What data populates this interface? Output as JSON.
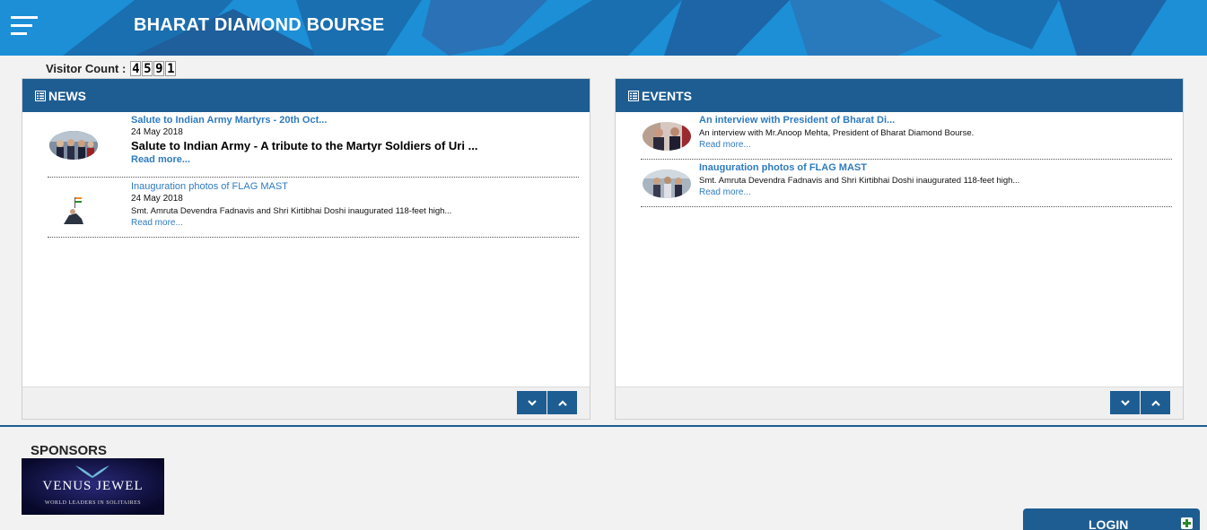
{
  "header": {
    "title": "BHARAT DIAMOND BOURSE"
  },
  "visitor": {
    "label": "Visitor Count :",
    "digits": [
      "4",
      "5",
      "9",
      "1"
    ]
  },
  "news": {
    "heading": "NEWS",
    "items": [
      {
        "title": "Salute to Indian Army Martyrs - 20th Oct...",
        "date": "24 May 2018",
        "headline": "Salute to Indian Army - A tribute to the Martyr Soldiers of Uri ...",
        "read_more": "Read more..."
      },
      {
        "title": "Inauguration photos of FLAG MAST",
        "date": "24 May 2018",
        "description": "Smt. Amruta Devendra Fadnavis and Shri Kirtibhai Doshi inaugurated 118-feet high...",
        "read_more": "Read more..."
      }
    ]
  },
  "events": {
    "heading": "EVENTS",
    "items": [
      {
        "title": "An interview with President of Bharat Di...",
        "description": "An interview with Mr.Anoop Mehta, President of Bharat Diamond Bourse.",
        "read_more": "Read more..."
      },
      {
        "title": "Inauguration photos of FLAG MAST",
        "description": "Smt. Amruta Devendra Fadnavis and Shri Kirtibhai Doshi inaugurated 118-feet high...",
        "read_more": "Read more..."
      }
    ]
  },
  "sponsors": {
    "heading": "SPONSORS",
    "logo_name": "VENUS JEWEL",
    "logo_tagline": "WORLD LEADERS IN SOLITAIRES"
  },
  "login": {
    "label": "LOGIN"
  },
  "icons": {
    "menu": "hamburger-menu-icon",
    "list": "list-icon",
    "down": "chevron-down-icon",
    "up": "chevron-up-icon",
    "plus": "plus-icon"
  },
  "colors": {
    "header_bg": "#1c8fd6",
    "panel_head": "#1d5d92",
    "link": "#2e7bbf",
    "plus": "#2a8a2a"
  }
}
